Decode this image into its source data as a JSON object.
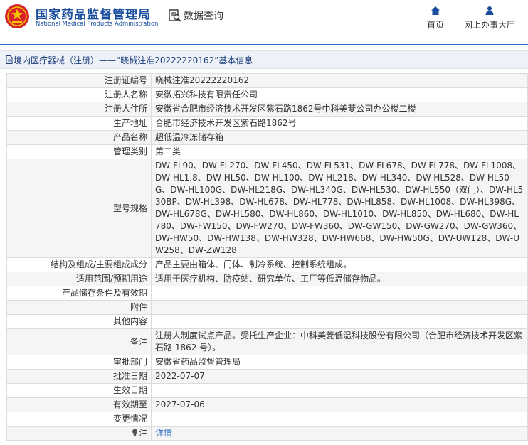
{
  "header": {
    "brand_cn": "国家药品监督管理局",
    "brand_en": "National Medical Products Administration",
    "data_query": "数据查询",
    "nav_home": "首页",
    "nav_office": "网上办事大厅"
  },
  "breadcrumb": {
    "text": "境内医疗器械（注册）——“晓械注准20222220162”基本信息"
  },
  "rows": [
    {
      "label": "注册证编号",
      "value": "晓械注准20222220162"
    },
    {
      "label": "注册人名称",
      "value": "安徽拓兴科技有限责任公司"
    },
    {
      "label": "注册人住所",
      "value": "安徽省合肥市经济技术开发区紫石路1862号中科美菱公司办公楼二楼"
    },
    {
      "label": "生产地址",
      "value": "合肥市经济技术开发区紫石路1862号"
    },
    {
      "label": "产品名称",
      "value": "超低温冷冻储存箱"
    },
    {
      "label": "管理类别",
      "value": "第二类"
    },
    {
      "label": "型号规格",
      "value": "DW-FL90、DW-FL270、DW-FL450、DW-FL531、DW-FL678、DW-FL778、DW-FL1008、DW-HL1.8、DW-HL50、DW-HL100、DW-HL218、DW-HL340、DW-HL528、DW-HL50G、DW-HL100G、DW-HL218G、DW-HL340G、DW-HL530、DW-HL550（双门）、DW-HL530BP、DW-HL398、DW-HL678、DW-HL778、DW-HL858、DW-HL1008、DW-HL398G、DW-HL678G、DW-HL580、DW-HL860、DW-HL1010、DW-HL850、DW-HL680、DW-HL780、DW-FW150、DW-FW270、DW-FW360、DW-GW150、DW-GW270、DW-GW360、DW-HW50、DW-HW138、DW-HW328、DW-HW668、DW-HW50G、DW-UW128、DW-UW258、DW-ZW128"
    },
    {
      "label": "结构及组成/主要组成成分",
      "value": "产品主要由箱体、门体、制冷系统、控制系统组成。"
    },
    {
      "label": "适用范围/预期用途",
      "value": "适用于医疗机构、防疫站、研究单位、工厂等低温储存物品。"
    },
    {
      "label": "产品储存条件及有效期",
      "value": ""
    },
    {
      "label": "附件",
      "value": ""
    },
    {
      "label": "其他内容",
      "value": ""
    },
    {
      "label": "备注",
      "value": "注册人制度试点产品。受托生产企业：中科美菱低温科技股份有限公司（合肥市经济技术开发区紫石路 1862 号）。"
    },
    {
      "label": "审批部门",
      "value": "安徽省药品监督管理局"
    },
    {
      "label": "批准日期",
      "value": "2022-07-07"
    },
    {
      "label": "生效日期",
      "value": ""
    },
    {
      "label": "有效期至",
      "value": "2027-07-06"
    },
    {
      "label": "变更情况",
      "value": ""
    }
  ],
  "note_row": {
    "label": "注",
    "link": "详情"
  },
  "colors": {
    "brand_blue": "#1a4e9d",
    "accent_blue": "#2b6cc4",
    "logo_red": "#d7242a"
  }
}
